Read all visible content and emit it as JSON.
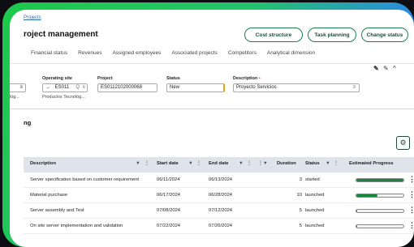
{
  "breadcrumb": "Projects",
  "page_title": "roject management",
  "header_buttons": {
    "cost_structure": "Cost structure",
    "task_planning": "Task planning",
    "change_status": "Change status"
  },
  "tabs": [
    "Financial status",
    "Revenues",
    "Assigned employees",
    "Associated projects",
    "Competitors",
    "Analytical dimension"
  ],
  "form": {
    "col0_value": "≡",
    "col0_sub": "lóg...",
    "operating_site_label": "Operating site",
    "operating_site_value": "ES011",
    "operating_site_sub": "Productos Tecnológ...",
    "project_label": "Project",
    "project_value": "ES0112102000068",
    "status_label": "Status",
    "status_value": "New",
    "description_label": "Description",
    "required_mark": "•",
    "description_value": "Proyecto Servicios"
  },
  "section_title": "ng",
  "table": {
    "headers": {
      "description": "Description",
      "start_date": "Start date",
      "end_date": "End date",
      "duration": "Duration",
      "status": "Status",
      "progress": "Estimated Progress"
    },
    "rows": [
      {
        "description": "Server specification based on customer requirement",
        "start": "06/11/2024",
        "end": "06/13/2024",
        "duration": "3",
        "status": "started",
        "progress": 1.0
      },
      {
        "description": "Material purchase",
        "start": "06/17/2024",
        "end": "06/28/2024",
        "duration": "10",
        "status": "launched",
        "progress": 0.45
      },
      {
        "description": "Server assembly and Test",
        "start": "07/08/2024",
        "end": "07/12/2024",
        "duration": "5",
        "status": "launched",
        "progress": 0.02
      },
      {
        "description": "On site server implementation and validation",
        "start": "07/22/2024",
        "end": "07/26/2024",
        "duration": "5",
        "status": "launched",
        "progress": 0.02
      }
    ]
  },
  "icons": {
    "filter": "▼",
    "column_menu": "⋮",
    "gear": "⚙",
    "kebab": "⋮",
    "pin": "✎",
    "collapse": "^",
    "list": "≡",
    "search": "Q",
    "arrow": "→"
  }
}
